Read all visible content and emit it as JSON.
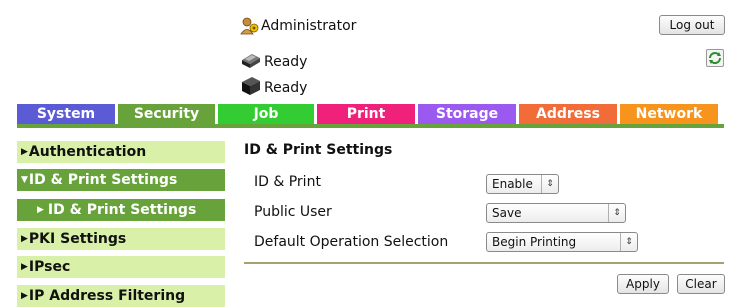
{
  "header": {
    "user": "Administrator",
    "logout_label": "Log out",
    "status": [
      {
        "icon": "printer-icon",
        "text": "Ready"
      },
      {
        "icon": "scanner-icon",
        "text": "Ready"
      }
    ],
    "refresh_icon": "refresh-icon"
  },
  "tabs": [
    {
      "label": "System",
      "color": "#5b5bd6"
    },
    {
      "label": "Security",
      "color": "#67a33a"
    },
    {
      "label": "Job",
      "color": "#33cc33"
    },
    {
      "label": "Print",
      "color": "#f0217a"
    },
    {
      "label": "Storage",
      "color": "#9b59f0"
    },
    {
      "label": "Address",
      "color": "#f26c3a"
    },
    {
      "label": "Network",
      "color": "#f7941d"
    }
  ],
  "sidebar": {
    "items": [
      {
        "label": "Authentication"
      },
      {
        "label": "ID & Print Settings"
      },
      {
        "label": "ID & Print Settings"
      },
      {
        "label": "PKI Settings"
      },
      {
        "label": "IPsec"
      },
      {
        "label": "IP Address Filtering"
      }
    ]
  },
  "main": {
    "title": "ID & Print Settings",
    "rows": [
      {
        "label": "ID & Print",
        "value": "Enable"
      },
      {
        "label": "Public User",
        "value": "Save"
      },
      {
        "label": "Default Operation Selection",
        "value": "Begin Printing"
      }
    ],
    "apply_label": "Apply",
    "clear_label": "Clear"
  },
  "colors": {
    "tab_underline": "#67a33a",
    "sidebar_light": "#d8f0a8",
    "sidebar_dark": "#67a33a",
    "divider": "#a8a070"
  }
}
